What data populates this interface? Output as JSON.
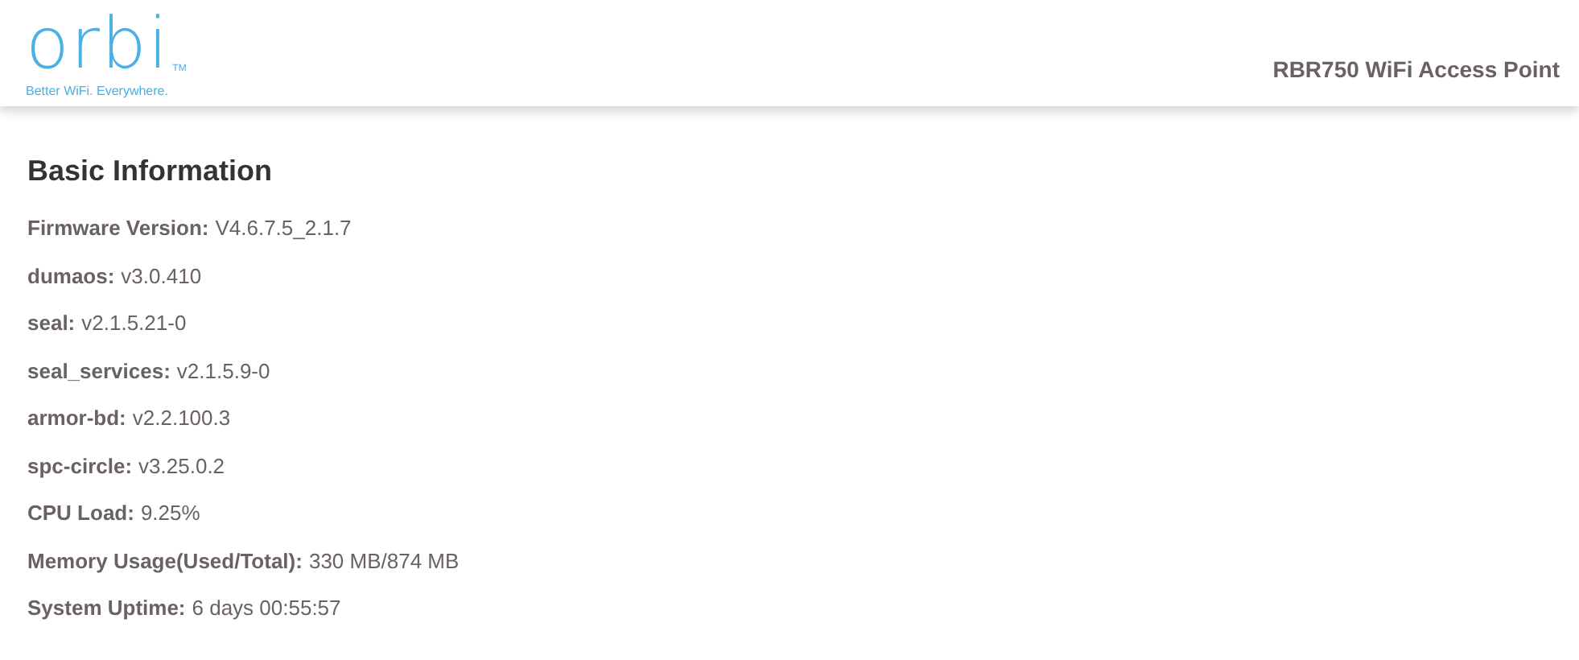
{
  "header": {
    "logo": "orbi",
    "trademark": "TM",
    "tagline": "Better WiFi. Everywhere.",
    "device_title": "RBR750 WiFi Access Point"
  },
  "section": {
    "title": "Basic Information",
    "items": [
      {
        "label": "Firmware Version:",
        "value": "V4.6.7.5_2.1.7"
      },
      {
        "label": "dumaos:",
        "value": "v3.0.410"
      },
      {
        "label": "seal:",
        "value": "v2.1.5.21-0"
      },
      {
        "label": "seal_services:",
        "value": "v2.1.5.9-0"
      },
      {
        "label": "armor-bd:",
        "value": "v2.2.100.3"
      },
      {
        "label": "spc-circle:",
        "value": "v3.25.0.2"
      },
      {
        "label": "CPU Load:",
        "value": "9.25%"
      },
      {
        "label": "Memory Usage(Used/Total):",
        "value": "330 MB/874 MB"
      },
      {
        "label": "System Uptime:",
        "value": "6 days 00:55:57"
      }
    ]
  }
}
